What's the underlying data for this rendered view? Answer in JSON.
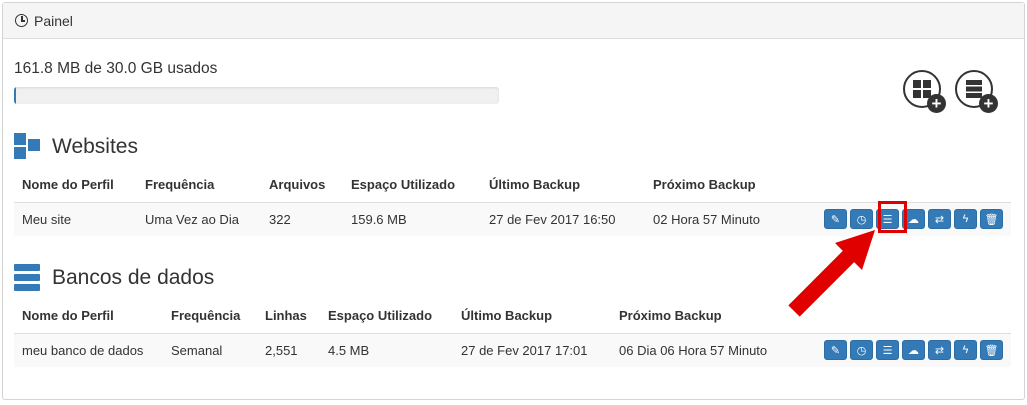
{
  "panel": {
    "title": "Painel"
  },
  "usage": {
    "text": "161.8 MB de 30.0 GB usados",
    "percent": 0.5
  },
  "add_buttons": [
    {
      "icon": "add-website-icon"
    },
    {
      "icon": "add-database-icon"
    }
  ],
  "websites": {
    "title": "Websites",
    "columns": [
      "Nome do Perfil",
      "Frequência",
      "Arquivos",
      "Espaço Utilizado",
      "Último Backup",
      "Próximo Backup"
    ],
    "rows": [
      [
        "Meu site",
        "Uma Vez ao Dia",
        "322",
        "159.6 MB",
        "27 de Fev 2017 16:50",
        "02 Hora 57 Minuto"
      ]
    ]
  },
  "databases": {
    "title": "Bancos de dados",
    "columns": [
      "Nome do Perfil",
      "Frequência",
      "Linhas",
      "Espaço Utilizado",
      "Último Backup",
      "Próximo Backup"
    ],
    "rows": [
      [
        "meu banco de dados",
        "Semanal",
        "2,551",
        "4.5 MB",
        "27 de Fev 2017 17:01",
        "06 Dia 06 Hora 57 Minuto"
      ]
    ]
  },
  "row_actions": [
    "edit-icon",
    "clock-icon",
    "list-icon",
    "cloud-upload-icon",
    "refresh-icon",
    "bolt-icon",
    "trash-icon"
  ],
  "colors": {
    "primary": "#337ab7",
    "highlight": "#e00000"
  }
}
